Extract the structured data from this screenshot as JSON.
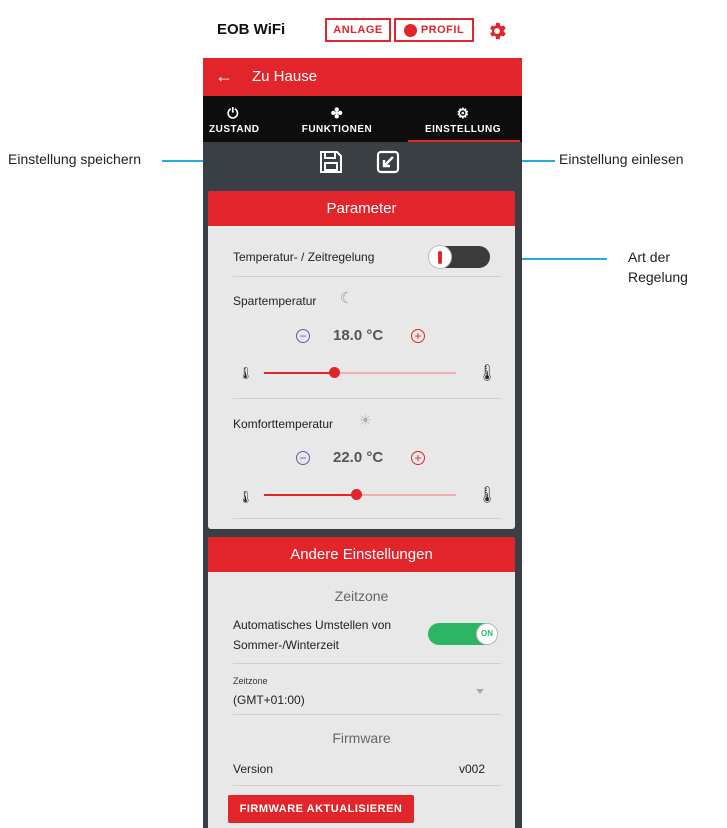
{
  "app": {
    "title": "EOB WiFi",
    "anlage_label": "ANLAGE",
    "profil_label": "PROFIL"
  },
  "nav": {
    "back_icon": "arrow-left-icon",
    "title": "Zu Hause"
  },
  "tabs": [
    {
      "label": "ZUSTAND",
      "icon": "power-icon"
    },
    {
      "label": "FUNKTIONEN",
      "icon": "functions-icon"
    },
    {
      "label": "EINSTELLUNG",
      "icon": "gear-icon",
      "active": true
    }
  ],
  "annotations": {
    "save": "Einstellung speichern",
    "load": "Einstellung einlesen",
    "mode_line1": "Art der",
    "mode_line2": "Regelung"
  },
  "parameter": {
    "header": "Parameter",
    "mode_label": "Temperatur- / Zeitregelung",
    "spar_label": "Spartemperatur",
    "spar_value": "18.0 °C",
    "spar_slider": 0.35,
    "komfort_label": "Komforttemperatur",
    "komfort_value": "22.0 °C",
    "komfort_slider": 0.47
  },
  "other": {
    "header": "Andere Einstellungen",
    "zeitzone_title": "Zeitzone",
    "auto_line1": "Automatisches Umstellen von",
    "auto_line2": "Sommer-/Winterzeit",
    "toggle_on": "ON",
    "zeitzone_small": "Zeitzone",
    "zeitzone_value": "(GMT+01:00)",
    "firmware_title": "Firmware",
    "version_label": "Version",
    "version_value": "v002",
    "update_button": "FIRMWARE AKTUALISIEREN"
  },
  "colors": {
    "accent": "#e1252b",
    "annotation": "#27aae1",
    "toggle_on": "#2db566"
  }
}
